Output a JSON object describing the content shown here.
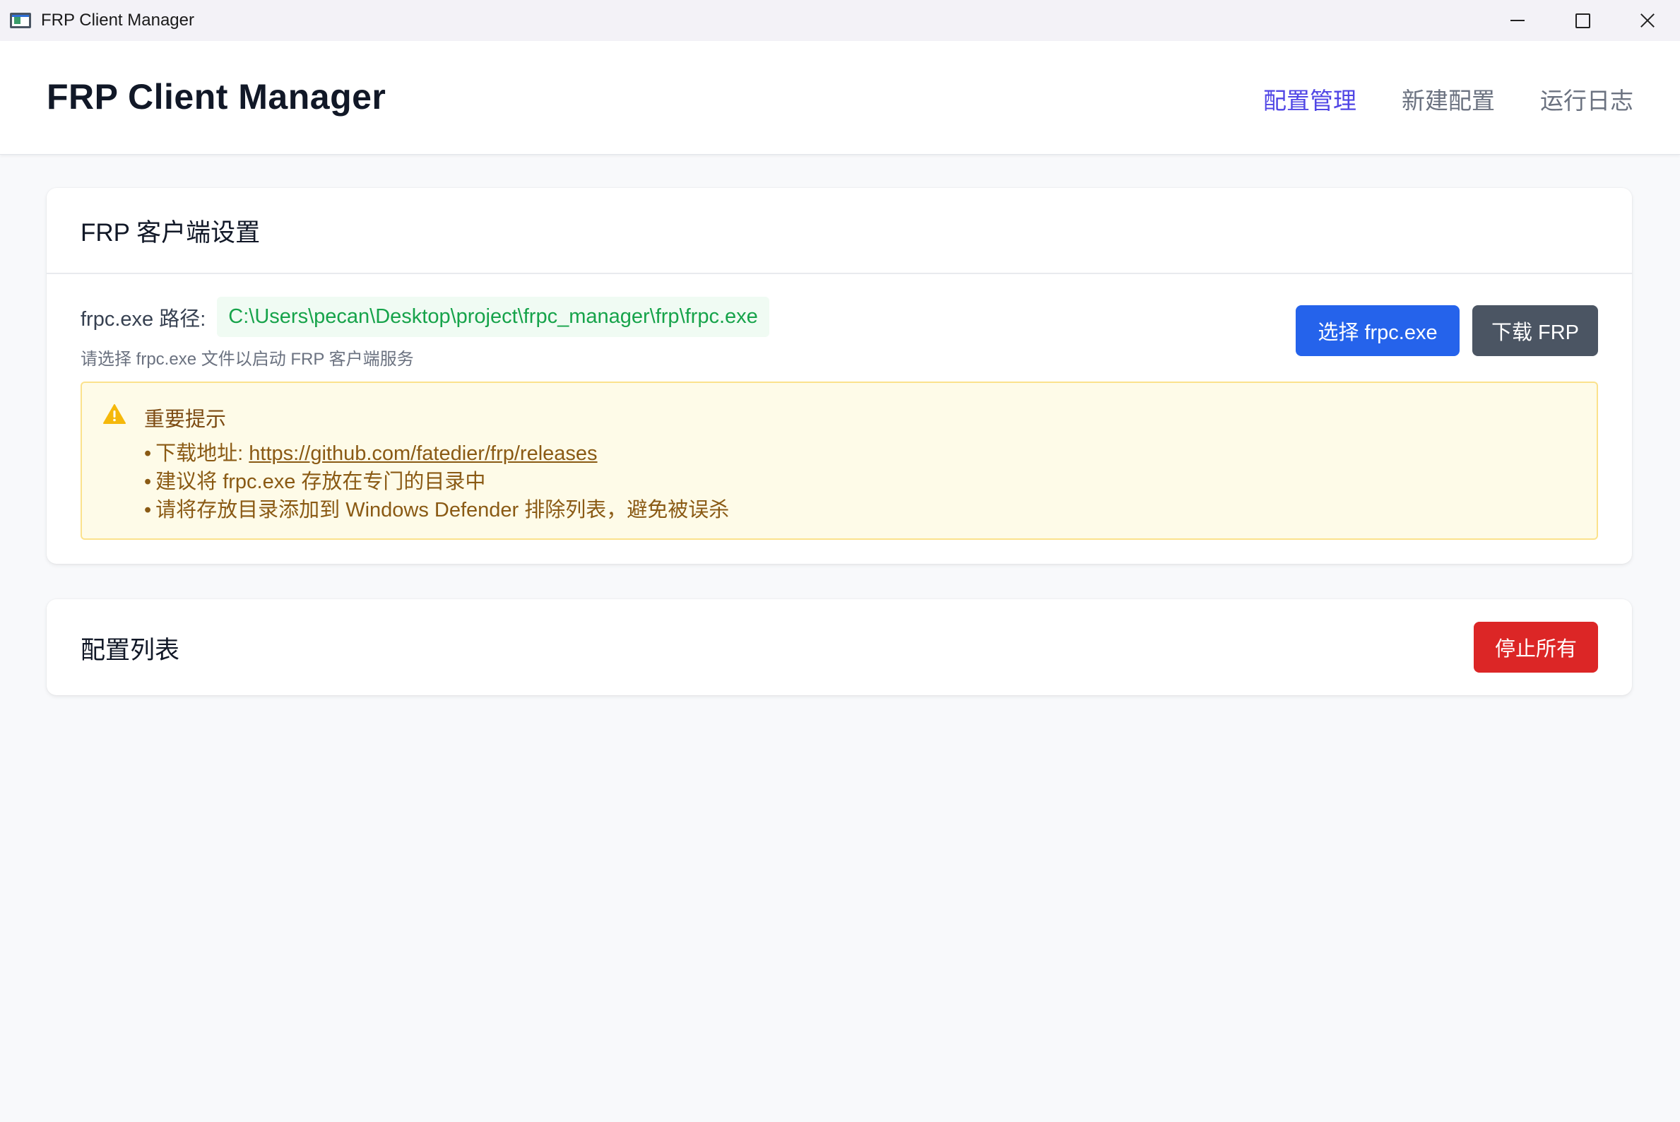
{
  "window": {
    "title": "FRP Client Manager",
    "icon": "app-window-icon",
    "controls": [
      "minimize-icon",
      "maximize-icon",
      "close-icon"
    ]
  },
  "header": {
    "brand": "FRP Client Manager",
    "nav": [
      {
        "label": "配置管理",
        "active": true
      },
      {
        "label": "新建配置",
        "active": false
      },
      {
        "label": "运行日志",
        "active": false
      }
    ]
  },
  "settings": {
    "title": "FRP 客户端设置",
    "path_label": "frpc.exe 路径:",
    "path_value": "C:\\Users\\pecan\\Desktop\\project\\frpc_manager\\frp\\frpc.exe",
    "hint": "请选择 frpc.exe 文件以启动 FRP 客户端服务",
    "select_button": "选择 frpc.exe",
    "download_button": "下载 FRP",
    "notice": {
      "icon": "warning-icon",
      "title": "重要提示",
      "download_prefix": "下载地址: ",
      "download_url": "https://github.com/fatedier/frp/releases",
      "items": [
        "建议将 frpc.exe 存放在专门的目录中",
        "请将存放目录添加到 Windows Defender 排除列表，避免被误杀"
      ]
    }
  },
  "config_list": {
    "title": "配置列表",
    "stop_all_button": "停止所有"
  },
  "colors": {
    "accent_nav": "#5046e5",
    "primary_button": "#2563eb",
    "secondary_button": "#4b5563",
    "danger_button": "#dc2626",
    "path_text": "#16a34a",
    "notice_bg": "#fefbe8",
    "notice_border": "#fbe28c"
  }
}
